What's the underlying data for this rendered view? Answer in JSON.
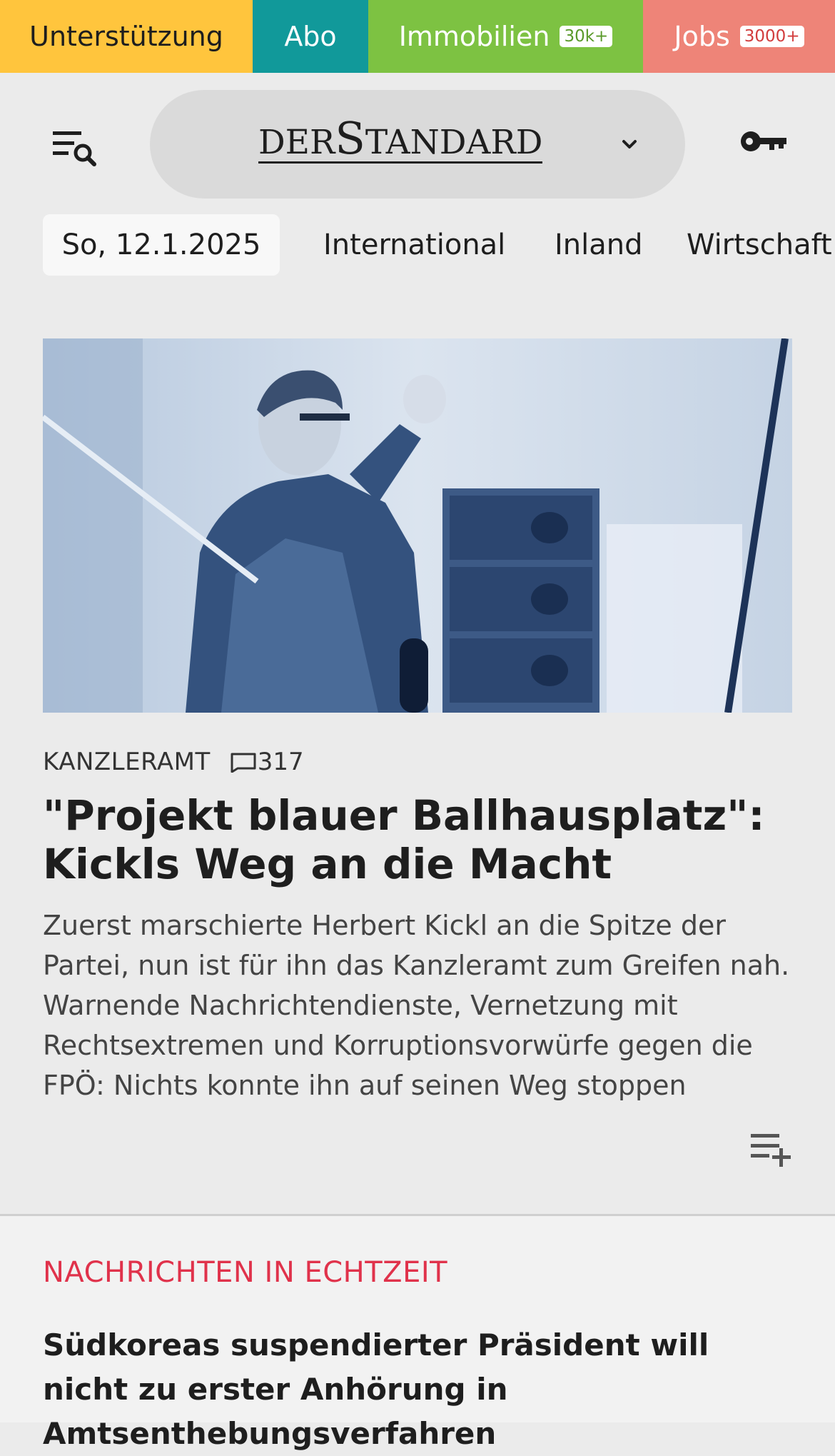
{
  "topbar": {
    "support": "Unterstützung",
    "abo": "Abo",
    "immobilien": "Immobilien",
    "immobilien_badge": "30k+",
    "jobs": "Jobs",
    "jobs_badge": "3000+"
  },
  "header": {
    "brand_small": "DER",
    "brand_s": "S",
    "brand_rest": "TANDARD",
    "menu_icon": "menu-search-icon",
    "chevron_icon": "chevron-down-icon",
    "login_icon": "key-icon"
  },
  "nav": {
    "date": "So, 12.1.2025",
    "items": [
      "International",
      "Inland",
      "Wirtschaft"
    ]
  },
  "article": {
    "kicker": "KANZLERAMT",
    "comment_count": "317",
    "headline": "\"Projekt blauer Ballhausplatz\": Kickls Weg an die Macht",
    "teaser": "Zuerst marschierte Herbert Kickl an die Spitze der Partei, nun ist für ihn das Kanzleramt zum Greifen nah. Warnende Nachrichtendienste, Vernetzung mit Rechtsextremen und Korruptionsvorwürfe gegen die FPÖ: Nichts konnte ihn auf seinen Weg stoppen",
    "add_icon": "playlist-add-icon"
  },
  "live": {
    "title": "NACHRICHTEN IN ECHTZEIT",
    "headline": "Südkoreas suspendierter Präsident will nicht zu erster Anhörung in Amtsenthebungsverfahren"
  },
  "colors": {
    "support": "#ffc53d",
    "abo": "#11999a",
    "immobilien": "#7dc242",
    "jobs": "#ee8478",
    "live_accent": "#e0324b",
    "background": "#ebebeb"
  }
}
